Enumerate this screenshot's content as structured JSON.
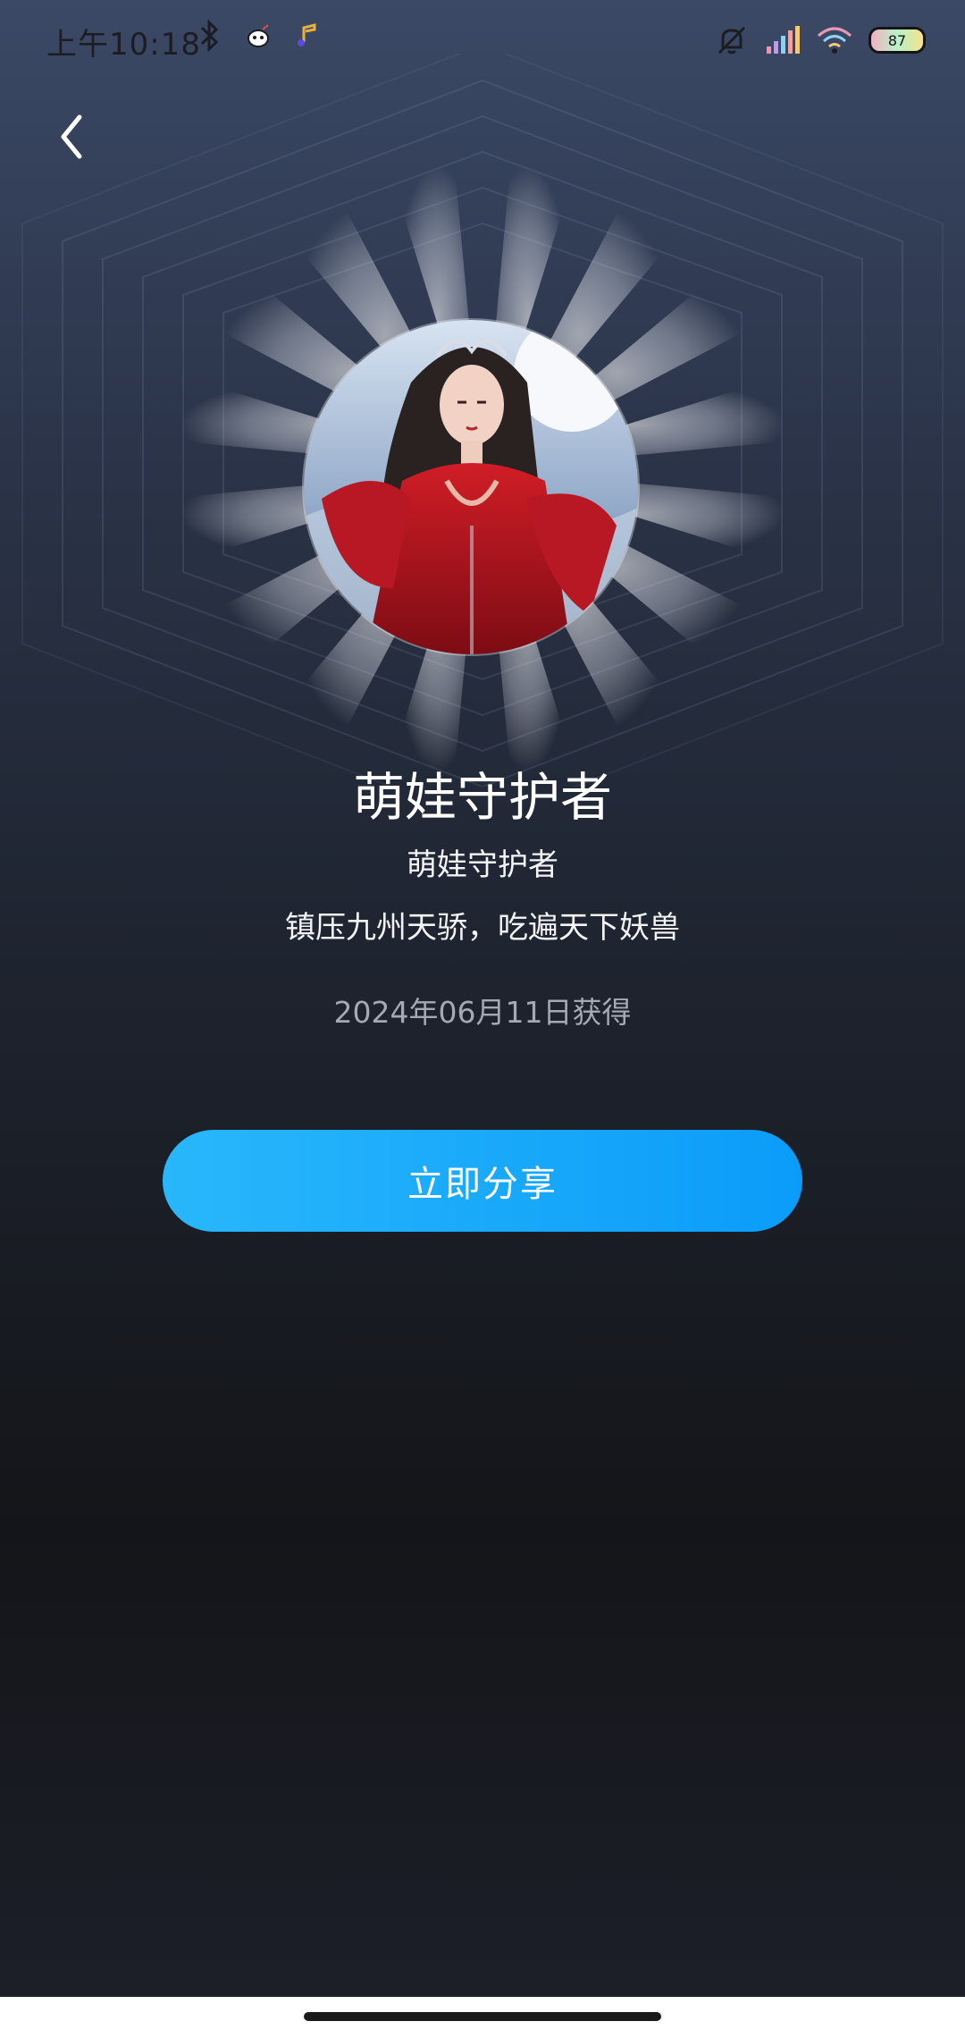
{
  "status_bar": {
    "time": "上午10:18",
    "battery_level": "87",
    "left_icons": [
      "bluetooth-icon",
      "app-notification-icon",
      "music-notification-icon"
    ],
    "right_icons": [
      "mute-bell-icon",
      "signal-icon",
      "wifi-icon",
      "battery-icon"
    ]
  },
  "header": {
    "back_icon": "chevron-left-icon"
  },
  "badge": {
    "title": "萌娃守护者",
    "subtitle": "萌娃守护者",
    "description": "镇压九州天骄，吃遍天下妖兽",
    "date": "2024年06月11日获得"
  },
  "actions": {
    "share_label": "立即分享"
  },
  "colors": {
    "share_start": "#29b7fb",
    "share_end": "#0b9cfa",
    "text_secondary": "#a5a9b3"
  }
}
